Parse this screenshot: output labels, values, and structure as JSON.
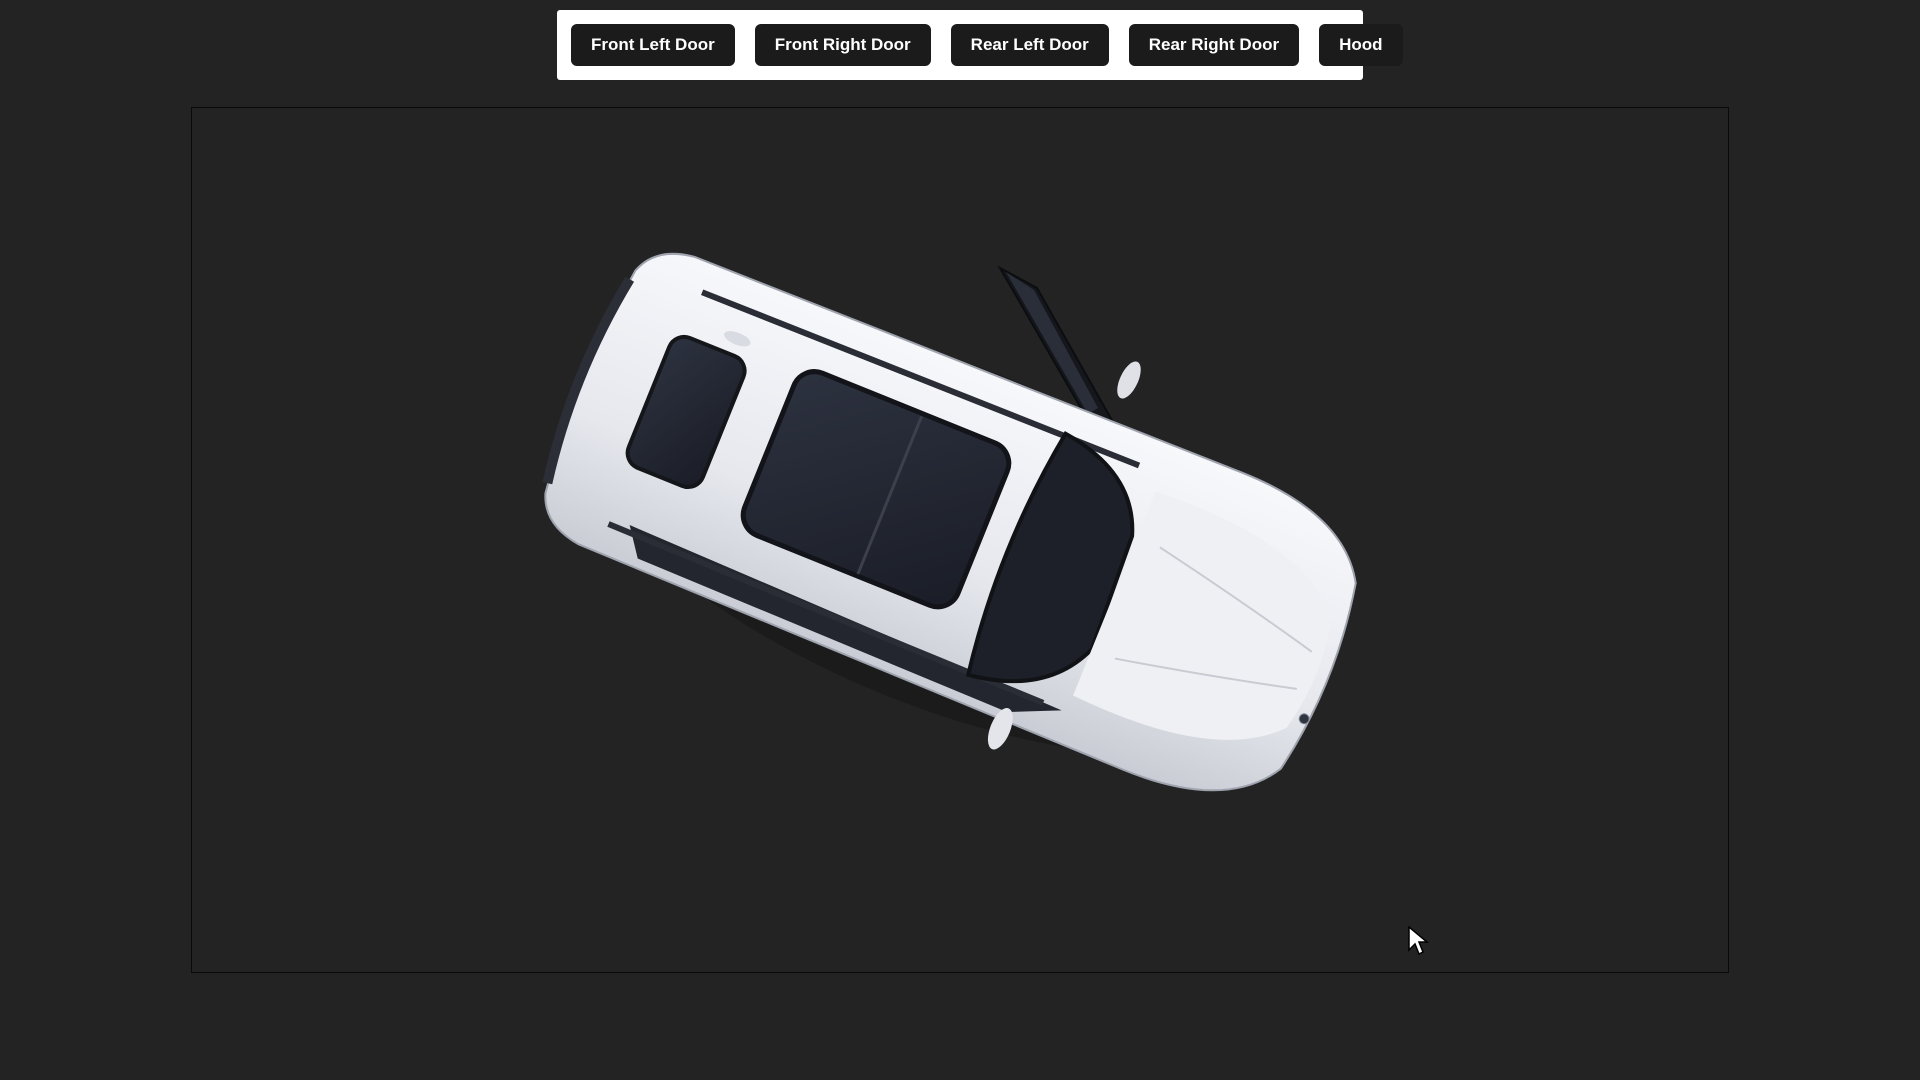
{
  "toolbar": {
    "buttons": [
      {
        "label": "Front Left Door"
      },
      {
        "label": "Front Right Door"
      },
      {
        "label": "Rear Left Door"
      },
      {
        "label": "Rear Right Door"
      },
      {
        "label": "Hood"
      }
    ]
  },
  "viewer": {
    "subject": "car-3d-model-icon",
    "open_part": "front-right-door"
  },
  "colors": {
    "page_background": "#232323",
    "toolbar_background": "#ffffff",
    "button_background": "#1b1b1b",
    "button_text": "#ffffff",
    "car_body": "#eceef3"
  }
}
